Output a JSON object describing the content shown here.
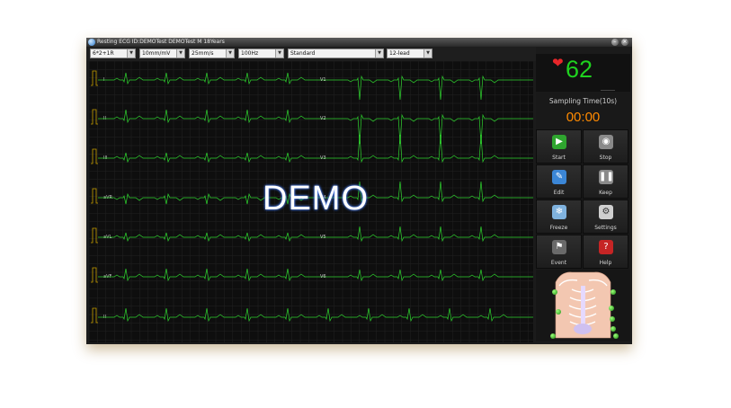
{
  "window": {
    "title": "Resting ECG ID:DEMOTest DEMOTest  M  18Years",
    "min_label": "–",
    "close_label": "×"
  },
  "toolbar": {
    "dropdowns": [
      {
        "value": "6*2+1R"
      },
      {
        "value": "10mm/mV"
      },
      {
        "value": "25mm/s"
      },
      {
        "value": "100Hz"
      },
      {
        "value": "Standard"
      },
      {
        "value": "12-lead"
      }
    ]
  },
  "ecg": {
    "left_leads": [
      "I",
      "II",
      "III",
      "aVR",
      "aVL",
      "aVF",
      "II"
    ],
    "right_leads": [
      "V1",
      "V2",
      "V3",
      "V4",
      "V5",
      "V6"
    ],
    "watermark": "DEMO",
    "grid_color": "#232323",
    "trace_color": "#2fd52f"
  },
  "vitals": {
    "heart_icon": "heart-icon",
    "heart_rate": "62",
    "sampling_label": "Sampling Time(10s)",
    "timer": "00:00"
  },
  "buttons": [
    {
      "label": "Start",
      "icon": "play-icon",
      "color": "#2fa52f"
    },
    {
      "label": "Stop",
      "icon": "stop-icon",
      "color": "#8a8a8a"
    },
    {
      "label": "Edit",
      "icon": "edit-icon",
      "color": "#3b86d6"
    },
    {
      "label": "Keep",
      "icon": "pause-icon",
      "color": "#8a8a8a"
    },
    {
      "label": "Freeze",
      "icon": "snowflake-icon",
      "color": "#7fb2de"
    },
    {
      "label": "Settings",
      "icon": "gear-icon",
      "color": "#cfcfcf"
    },
    {
      "label": "Event",
      "icon": "flag-icon",
      "color": "#6a6a6a"
    },
    {
      "label": "Help",
      "icon": "help-icon",
      "color": "#c62525"
    }
  ],
  "colors": {
    "heart_rate": "#1fd21f",
    "timer": "#ff8a00",
    "heart": "#e8262a"
  }
}
